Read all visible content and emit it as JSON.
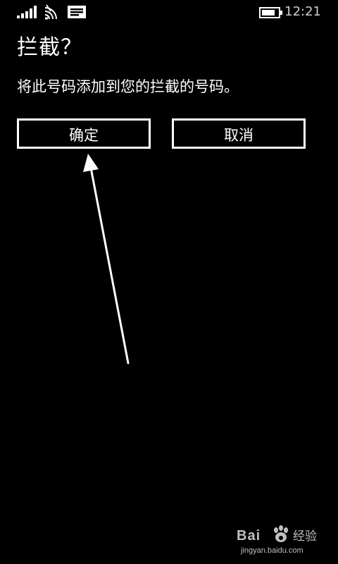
{
  "status_bar": {
    "time": "12:21",
    "icons": [
      "signal-icon",
      "wifi-icon",
      "message-icon",
      "battery-icon"
    ]
  },
  "dialog": {
    "title": "拦截？",
    "message": "将此号码添加到您的拦截的号码。",
    "confirm_label": "确定",
    "cancel_label": "取消"
  },
  "watermark": {
    "brand": "Bai",
    "product": "经验",
    "url": "jingyan.baidu.com"
  },
  "colors": {
    "background": "#000000",
    "foreground": "#ffffff",
    "status_text": "#cfcfcf"
  }
}
